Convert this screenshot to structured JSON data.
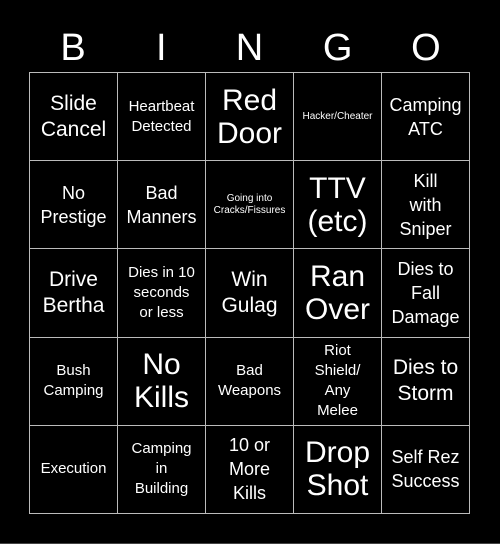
{
  "header": {
    "letters": [
      "B",
      "I",
      "N",
      "G",
      "O"
    ]
  },
  "cells": [
    {
      "text": "Slide\nCancel",
      "size": "lg"
    },
    {
      "text": "Heartbeat\nDetected",
      "size": "sm"
    },
    {
      "text": "Red\nDoor",
      "size": "xl"
    },
    {
      "text": "Hacker/Cheater",
      "size": "xs"
    },
    {
      "text": "Camping\nATC",
      "size": "md"
    },
    {
      "text": "No\nPrestige",
      "size": "md"
    },
    {
      "text": "Bad\nManners",
      "size": "md"
    },
    {
      "text": "Going into\nCracks/Fissures",
      "size": "xs"
    },
    {
      "text": "TTV\n(etc)",
      "size": "xl"
    },
    {
      "text": "Kill\nwith\nSniper",
      "size": "md"
    },
    {
      "text": "Drive\nBertha",
      "size": "lg"
    },
    {
      "text": "Dies in 10\nseconds\nor less",
      "size": "sm"
    },
    {
      "text": "Win\nGulag",
      "size": "lg"
    },
    {
      "text": "Ran\nOver",
      "size": "xl"
    },
    {
      "text": "Dies to\nFall\nDamage",
      "size": "md"
    },
    {
      "text": "Bush\nCamping",
      "size": "sm"
    },
    {
      "text": "No\nKills",
      "size": "xl"
    },
    {
      "text": "Bad\nWeapons",
      "size": "sm"
    },
    {
      "text": "Riot\nShield/\nAny\nMelee",
      "size": "sm"
    },
    {
      "text": "Dies to\nStorm",
      "size": "lg"
    },
    {
      "text": "Execution",
      "size": "sm"
    },
    {
      "text": "Camping\nin\nBuilding",
      "size": "sm"
    },
    {
      "text": "10 or\nMore\nKills",
      "size": "md"
    },
    {
      "text": "Drop\nShot",
      "size": "xl"
    },
    {
      "text": "Self Rez\nSuccess",
      "size": "md"
    }
  ]
}
